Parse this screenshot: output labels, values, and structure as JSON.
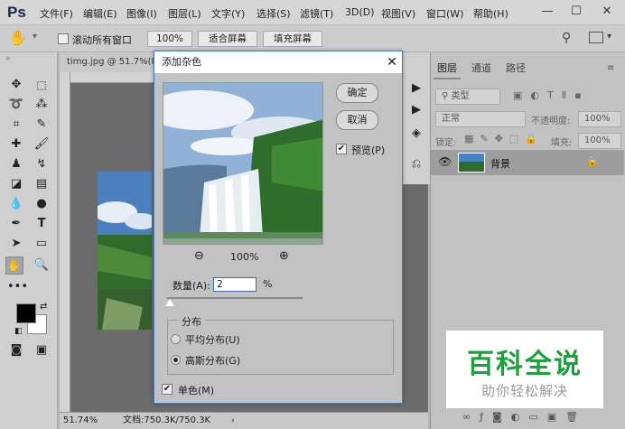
{
  "app": {
    "logo": "Ps"
  },
  "menubar": {
    "items": [
      "文件(F)",
      "编辑(E)",
      "图像(I)",
      "图层(L)",
      "文字(Y)",
      "选择(S)",
      "滤镜(T)",
      "3D(D)",
      "视图(V)",
      "窗口(W)",
      "帮助(H)"
    ],
    "win_min": "—",
    "win_max": "☐",
    "win_close": "✕"
  },
  "options": {
    "scroll_all_label": "滚动所有窗口",
    "zoom_100": "100%",
    "fit_screen": "适合屏幕",
    "fill_screen": "填充屏幕"
  },
  "document": {
    "tab_label": "timg.jpg @ 51.7%(R",
    "zoom": "51.74%",
    "doc_size": "文档:750.3K/750.3K"
  },
  "layers_panel": {
    "tabs": [
      "图层",
      "通道",
      "路径"
    ],
    "filter_kind": "类型",
    "blend_mode": "正常",
    "opacity_label": "不透明度:",
    "opacity_value": "100%",
    "lock_label": "锁定:",
    "fill_label": "填充:",
    "fill_value": "100%",
    "layer_name": "背景",
    "panel_footer_icons": [
      "link-icon",
      "fx-icon",
      "mask-icon",
      "adjustment-icon",
      "folder-icon",
      "new-layer-icon",
      "trash-icon"
    ]
  },
  "dialog": {
    "title": "添加杂色",
    "ok_label": "确定",
    "cancel_label": "取消",
    "preview_label": "预览(P)",
    "preview_checked": true,
    "zoom_level": "100%",
    "amount_label": "数量(A):",
    "amount_value": "2",
    "amount_unit": "%",
    "amount_slider_fraction": 0.0,
    "distribution_title": "分布",
    "uniform_label": "平均分布(U)",
    "gaussian_label": "高斯分布(G)",
    "selected_distribution": "gaussian",
    "mono_label": "单色(M)",
    "mono_checked": true
  },
  "watermark": {
    "title": "百科全说",
    "subtitle": "助你轻松解决",
    "title_color": "#1ea03c"
  },
  "colors": {
    "foreground": "#000000",
    "background": "#ffffff"
  }
}
